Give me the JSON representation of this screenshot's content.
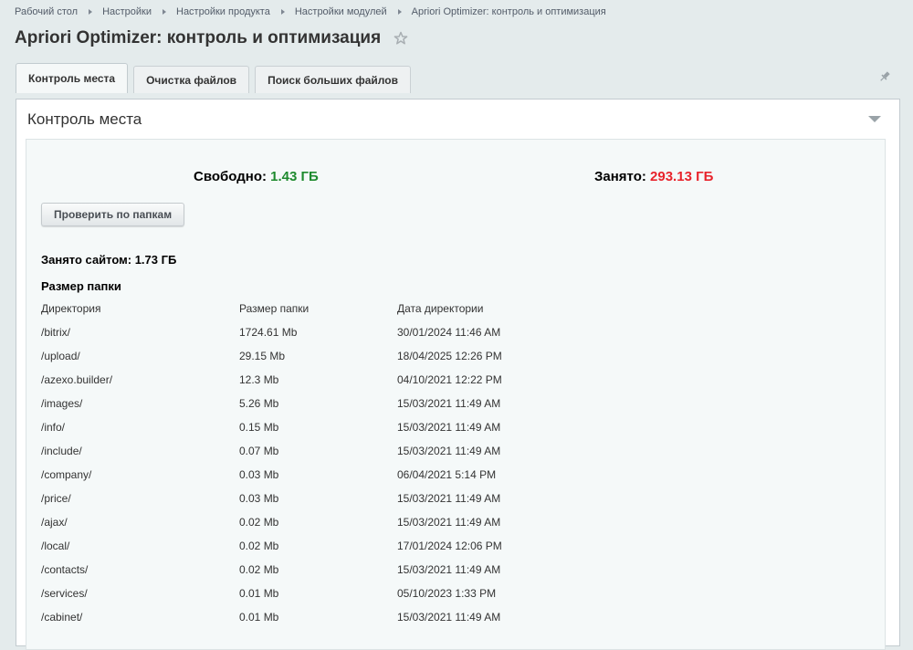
{
  "breadcrumb": [
    "Рабочий стол",
    "Настройки",
    "Настройки продукта",
    "Настройки модулей",
    "Apriori Optimizer: контроль и оптимизация"
  ],
  "page_title": "Apriori Optimizer: контроль и оптимизация",
  "tabs": [
    {
      "label": "Контроль места",
      "active": true
    },
    {
      "label": "Очистка файлов",
      "active": false
    },
    {
      "label": "Поиск больших файлов",
      "active": false
    }
  ],
  "section_title": "Контроль места",
  "free": {
    "label": "Свободно:",
    "value": "1.43 ГБ"
  },
  "used": {
    "label": "Занято:",
    "value": "293.13 ГБ"
  },
  "check_button": "Проверить по папкам",
  "site_used": "Занято сайтом: 1.73 ГБ",
  "folder_size_heading": "Размер папки",
  "table": {
    "headers": [
      "Директория",
      "Размер папки",
      "Дата директории"
    ],
    "rows": [
      [
        "/bitrix/",
        "1724.61 Mb",
        "30/01/2024 11:46 AM"
      ],
      [
        "/upload/",
        "29.15 Mb",
        "18/04/2025 12:26 PM"
      ],
      [
        "/azexo.builder/",
        "12.3 Mb",
        "04/10/2021 12:22 PM"
      ],
      [
        "/images/",
        "5.26 Mb",
        "15/03/2021 11:49 AM"
      ],
      [
        "/info/",
        "0.15 Mb",
        "15/03/2021 11:49 AM"
      ],
      [
        "/include/",
        "0.07 Mb",
        "15/03/2021 11:49 AM"
      ],
      [
        "/company/",
        "0.03 Mb",
        "06/04/2021 5:14 PM"
      ],
      [
        "/price/",
        "0.03 Mb",
        "15/03/2021 11:49 AM"
      ],
      [
        "/ajax/",
        "0.02 Mb",
        "15/03/2021 11:49 AM"
      ],
      [
        "/local/",
        "0.02 Mb",
        "17/01/2024 12:06 PM"
      ],
      [
        "/contacts/",
        "0.02 Mb",
        "15/03/2021 11:49 AM"
      ],
      [
        "/services/",
        "0.01 Mb",
        "05/10/2023 1:33 PM"
      ],
      [
        "/cabinet/",
        "0.01 Mb",
        "15/03/2021 11:49 AM"
      ]
    ]
  },
  "icons": {
    "favorite": "star-icon",
    "pin": "pin-icon",
    "collapse": "collapse-icon"
  },
  "colors": {
    "free_value": "#1e8a2e",
    "used_value": "#e8232b"
  }
}
